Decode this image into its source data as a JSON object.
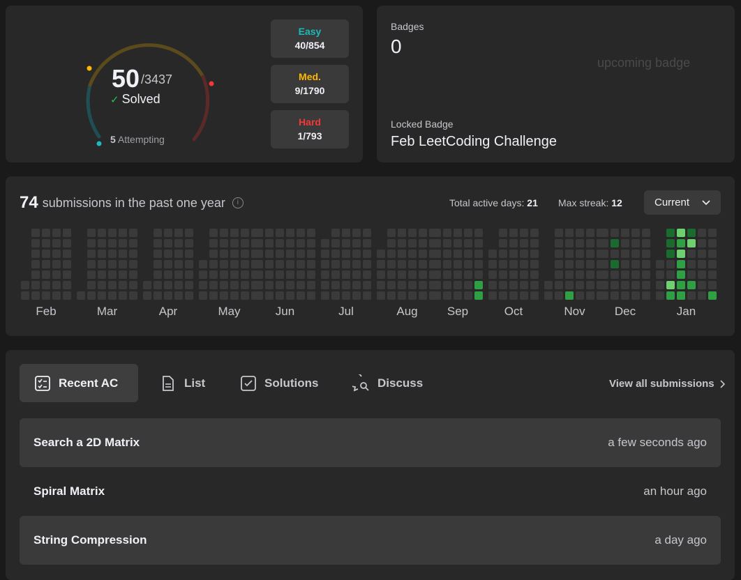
{
  "solved": {
    "count": "50",
    "total": "/3437",
    "label": "Solved",
    "attempting_count": "5",
    "attempting_label": "Attempting",
    "difficulties": [
      {
        "name": "Easy",
        "value": "40/854",
        "color": "#1cbaba"
      },
      {
        "name": "Med.",
        "value": "9/1790",
        "color": "#ffb700"
      },
      {
        "name": "Hard",
        "value": "1/793",
        "color": "#f63737"
      }
    ]
  },
  "badges": {
    "label": "Badges",
    "count": "0",
    "upcoming_alt": "upcoming badge",
    "locked_label": "Locked Badge",
    "locked_name": "Feb LeetCoding Challenge"
  },
  "submissions": {
    "count": "74",
    "text": "submissions in the past one year",
    "active_days_label": "Total active days:",
    "active_days": "21",
    "max_streak_label": "Max streak:",
    "max_streak": "12",
    "period": "Current",
    "months": [
      "Feb",
      "Mar",
      "Apr",
      "May",
      "Jun",
      "Jul",
      "Aug",
      "Sep",
      "Oct",
      "Nov",
      "Dec",
      "Jan"
    ],
    "colors": {
      "empty": "#3a3a3a",
      "low": "#0e4429",
      "mid": "#196c2e",
      "high": "#2ea043",
      "max": "#6fd06f"
    }
  },
  "recent": {
    "tabs": [
      {
        "label": "Recent AC",
        "icon": "recent-ac-icon",
        "active": true
      },
      {
        "label": "List",
        "icon": "list-icon",
        "active": false
      },
      {
        "label": "Solutions",
        "icon": "solutions-icon",
        "active": false
      },
      {
        "label": "Discuss",
        "icon": "discuss-icon",
        "active": false
      }
    ],
    "view_all": "View all submissions",
    "items": [
      {
        "title": "Search a 2D Matrix",
        "time": "a few seconds ago"
      },
      {
        "title": "Spiral Matrix",
        "time": "an hour ago"
      },
      {
        "title": "String Compression",
        "time": "a day ago"
      }
    ]
  }
}
